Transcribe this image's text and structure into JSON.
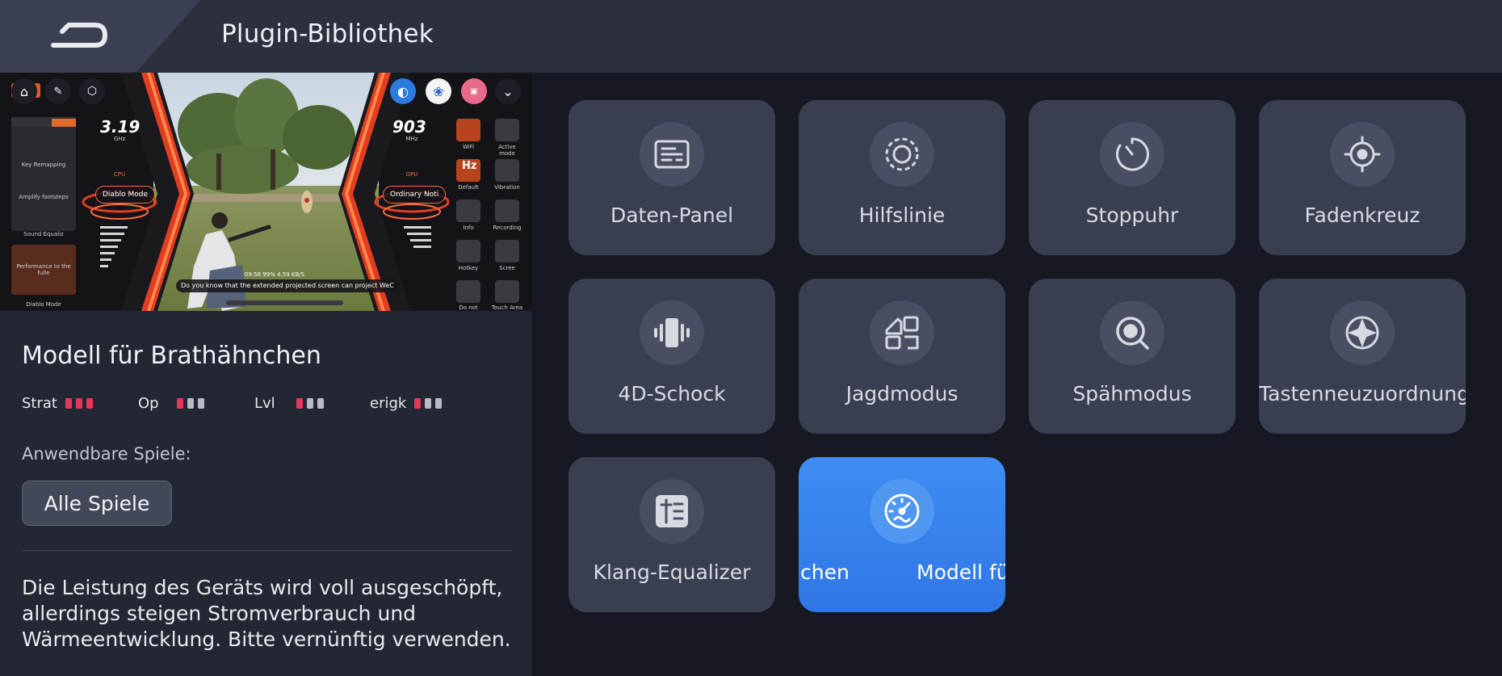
{
  "header": {
    "title": "Plugin-Bibliothek",
    "back_icon": "back-arrow-icon"
  },
  "preview": {
    "cpu_value": "3.19",
    "cpu_unit": "GHz",
    "cpu_label": "CPU",
    "gpu_value": "903",
    "gpu_unit": "MHz",
    "gpu_label": "GPU",
    "left_mode": "Diablo Mode",
    "right_mode": "Ordinary Noti",
    "tip": "Do you know that the extended projected screen can project WeC",
    "side_labels": [
      "Key Remapping",
      "Amplify footsteps",
      "Sound Equaliz",
      "Performance to the fulle",
      "Diablo Mode"
    ],
    "right_labels": [
      "WiFi",
      "Active mode",
      "Default",
      "Vibration",
      "Info",
      "Recording",
      "Hotkey",
      "Scree",
      "Do not disturb",
      "Touch Area"
    ],
    "right_hz": "Hz",
    "status_line": "09:56  99%  4.59 KB/S"
  },
  "model": {
    "title": "Modell für Brathähnchen",
    "stats": [
      {
        "label": "Strat",
        "level": 3
      },
      {
        "label": "Op",
        "level": 1
      },
      {
        "label": "Lvl",
        "level": 1
      },
      {
        "label": "erigk",
        "level": 1
      }
    ],
    "games_label": "Anwendbare Spiele:",
    "games_button": "Alle Spiele",
    "description": "Die Leistung des Geräts wird voll ausgeschöpft, allerdings steigen Stromverbrauch und Wärmeentwicklung. Bitte vernünftig verwenden."
  },
  "plugins": [
    {
      "label": "Daten-Panel",
      "icon": "data-panel-icon"
    },
    {
      "label": "Hilfslinie",
      "icon": "guide-line-icon"
    },
    {
      "label": "Stoppuhr",
      "icon": "stopwatch-icon"
    },
    {
      "label": "Fadenkreuz",
      "icon": "crosshair-icon"
    },
    {
      "label": "4D-Schock",
      "icon": "vibration-icon"
    },
    {
      "label": "Jagdmodus",
      "icon": "hunt-mode-icon"
    },
    {
      "label": "Spähmodus",
      "icon": "scout-mode-icon"
    },
    {
      "label": "Tastenneuzuordnung",
      "icon": "key-remap-icon"
    },
    {
      "label": "Klang-Equalizer",
      "icon": "sound-equalizer-icon"
    },
    {
      "label_part1": "chen",
      "label_part2": "Modell fü",
      "icon": "performance-gauge-icon",
      "selected": true
    }
  ],
  "colors": {
    "accent": "#3f8df2",
    "stat_on": "#e8365a",
    "tile_bg": "#3a3e51",
    "panel_bg": "#232633"
  }
}
